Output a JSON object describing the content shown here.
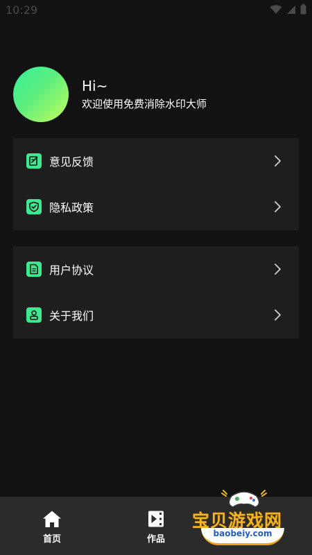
{
  "status_bar": {
    "time": "10:29",
    "icons": [
      "wifi-icon",
      "signal-icon",
      "battery-icon"
    ]
  },
  "profile": {
    "greeting": "Hi~",
    "subtitle": "欢迎使用免费消除水印大师"
  },
  "menu_groups": [
    {
      "items": [
        {
          "label": "意见反馈",
          "icon": "feedback-icon"
        },
        {
          "label": "隐私政策",
          "icon": "shield-icon"
        }
      ]
    },
    {
      "items": [
        {
          "label": "用户协议",
          "icon": "document-icon"
        },
        {
          "label": "关于我们",
          "icon": "user-icon"
        }
      ]
    }
  ],
  "bottom_nav": {
    "items": [
      {
        "label": "首页",
        "icon": "home-icon"
      },
      {
        "label": "作品",
        "icon": "video-icon"
      }
    ]
  },
  "watermark": {
    "brand": "宝贝游戏网",
    "url": "baobeiy.com"
  },
  "colors": {
    "background": "#121212",
    "card": "#1e1e1e",
    "accent": "#3ce890",
    "nav_background": "#2b2b2b"
  }
}
